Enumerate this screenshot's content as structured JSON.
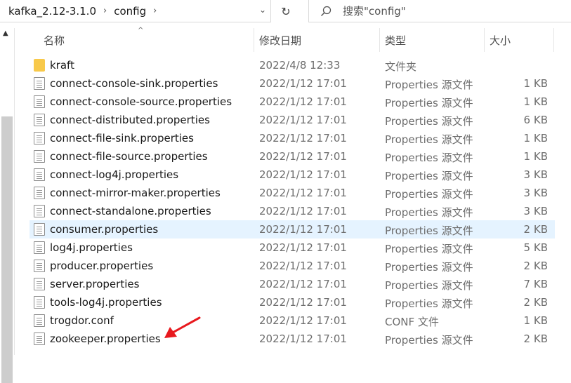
{
  "address": {
    "crumbs": [
      "kafka_2.12-3.1.0",
      "config"
    ],
    "separator": "›",
    "dropdown": "⌄"
  },
  "refresh_glyph": "↻",
  "search": {
    "placeholder": "搜索\"config\""
  },
  "columns": {
    "name": "名称",
    "date": "修改日期",
    "type": "类型",
    "size": "大小"
  },
  "sort_indicator": "^",
  "rows": [
    {
      "name": "kraft",
      "date": "2022/4/8 12:33",
      "type": "文件夹",
      "size": "",
      "icon": "folder-icon"
    },
    {
      "name": "connect-console-sink.properties",
      "date": "2022/1/12 17:01",
      "type": "Properties 源文件",
      "size": "1 KB",
      "icon": "file-icon"
    },
    {
      "name": "connect-console-source.properties",
      "date": "2022/1/12 17:01",
      "type": "Properties 源文件",
      "size": "1 KB",
      "icon": "file-icon"
    },
    {
      "name": "connect-distributed.properties",
      "date": "2022/1/12 17:01",
      "type": "Properties 源文件",
      "size": "6 KB",
      "icon": "file-icon"
    },
    {
      "name": "connect-file-sink.properties",
      "date": "2022/1/12 17:01",
      "type": "Properties 源文件",
      "size": "1 KB",
      "icon": "file-icon"
    },
    {
      "name": "connect-file-source.properties",
      "date": "2022/1/12 17:01",
      "type": "Properties 源文件",
      "size": "1 KB",
      "icon": "file-icon"
    },
    {
      "name": "connect-log4j.properties",
      "date": "2022/1/12 17:01",
      "type": "Properties 源文件",
      "size": "3 KB",
      "icon": "file-icon"
    },
    {
      "name": "connect-mirror-maker.properties",
      "date": "2022/1/12 17:01",
      "type": "Properties 源文件",
      "size": "3 KB",
      "icon": "file-icon"
    },
    {
      "name": "connect-standalone.properties",
      "date": "2022/1/12 17:01",
      "type": "Properties 源文件",
      "size": "3 KB",
      "icon": "file-icon"
    },
    {
      "name": "consumer.properties",
      "date": "2022/1/12 17:01",
      "type": "Properties 源文件",
      "size": "2 KB",
      "icon": "file-icon",
      "selected": true
    },
    {
      "name": "log4j.properties",
      "date": "2022/1/12 17:01",
      "type": "Properties 源文件",
      "size": "5 KB",
      "icon": "file-icon"
    },
    {
      "name": "producer.properties",
      "date": "2022/1/12 17:01",
      "type": "Properties 源文件",
      "size": "2 KB",
      "icon": "file-icon"
    },
    {
      "name": "server.properties",
      "date": "2022/1/12 17:01",
      "type": "Properties 源文件",
      "size": "7 KB",
      "icon": "file-icon"
    },
    {
      "name": "tools-log4j.properties",
      "date": "2022/1/12 17:01",
      "type": "Properties 源文件",
      "size": "2 KB",
      "icon": "file-icon"
    },
    {
      "name": "trogdor.conf",
      "date": "2022/1/12 17:01",
      "type": "CONF 文件",
      "size": "1 KB",
      "icon": "file-icon"
    },
    {
      "name": "zookeeper.properties",
      "date": "2022/1/12 17:01",
      "type": "Properties 源文件",
      "size": "2 KB",
      "icon": "file-icon"
    }
  ],
  "colors": {
    "selected_row": "#e5f3ff",
    "folder": "#f8c94a",
    "annotation_arrow": "#e8191e"
  }
}
